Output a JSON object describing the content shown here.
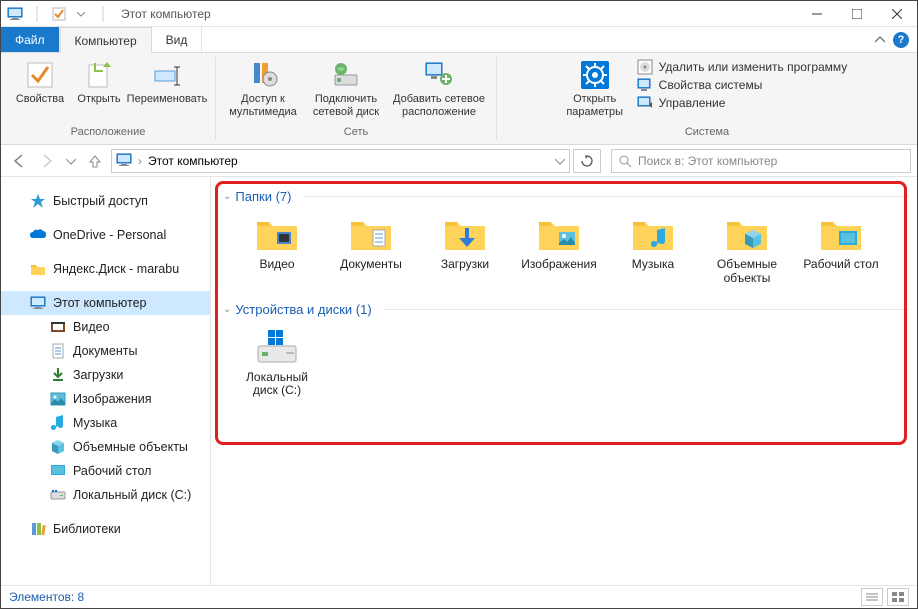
{
  "window": {
    "title": "Этот компьютер"
  },
  "tabs": {
    "file": "Файл",
    "computer": "Компьютер",
    "view": "Вид"
  },
  "ribbon": {
    "location": {
      "label": "Расположение",
      "properties": "Свойства",
      "open": "Открыть",
      "rename": "Переименовать"
    },
    "network": {
      "label": "Сеть",
      "media_access": "Доступ к мультимедиа",
      "map_drive": "Подключить сетевой диск",
      "add_location": "Добавить сетевое расположение"
    },
    "system": {
      "label": "Система",
      "open_params": "Открыть параметры",
      "uninstall": "Удалить или изменить программу",
      "sys_props": "Свойства системы",
      "manage": "Управление"
    }
  },
  "address": {
    "path": "Этот компьютер"
  },
  "search": {
    "placeholder": "Поиск в: Этот компьютер"
  },
  "nav": {
    "quick": "Быстрый доступ",
    "onedrive": "OneDrive - Personal",
    "yadisk": "Яндекс.Диск - marabu",
    "thispc": "Этот компьютер",
    "videos": "Видео",
    "documents": "Документы",
    "downloads": "Загрузки",
    "pictures": "Изображения",
    "music": "Музыка",
    "objects3d": "Объемные объекты",
    "desktop": "Рабочий стол",
    "localdisk": "Локальный диск (C:)",
    "libraries": "Библиотеки"
  },
  "sections": {
    "folders": {
      "title": "Папки (7)"
    },
    "devices": {
      "title": "Устройства и диски (1)"
    }
  },
  "folders": {
    "videos": "Видео",
    "documents": "Документы",
    "downloads": "Загрузки",
    "pictures": "Изображения",
    "music": "Музыка",
    "objects3d": "Объемные объекты",
    "desktop": "Рабочий стол"
  },
  "devices": {
    "localdisk": "Локальный диск (C:)"
  },
  "statusbar": {
    "text": "Элементов: 8"
  }
}
